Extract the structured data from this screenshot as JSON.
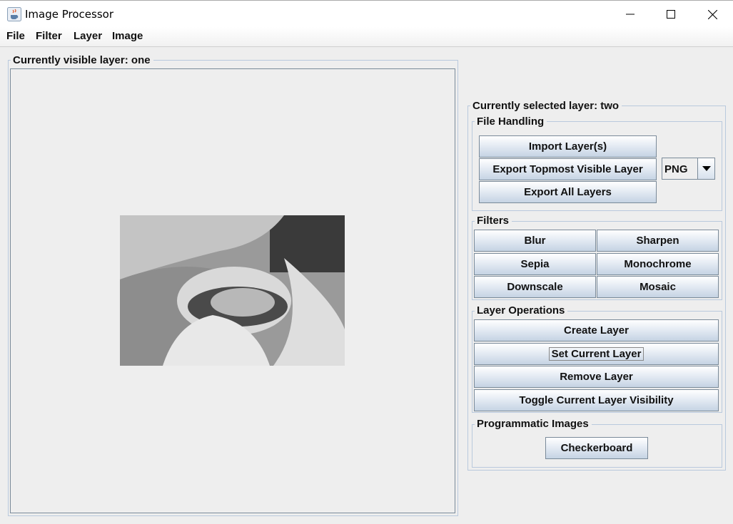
{
  "window": {
    "title": "Image Processor",
    "icon": "java-cup-icon",
    "controls": [
      "minimize-icon",
      "maximize-icon",
      "close-icon"
    ]
  },
  "menu": [
    "File",
    "Filter",
    "Layer",
    "Image"
  ],
  "canvas_panel": {
    "title": "Currently visible layer: one",
    "image_description_icon": "grayscale-photo"
  },
  "control_panel": {
    "title": "Currently selected layer: two",
    "file_handling": {
      "title": "File Handling",
      "import_label": "Import Layer(s)",
      "export_top_label": "Export Topmost Visible Layer",
      "export_all_label": "Export All Layers",
      "format_selected": "PNG"
    },
    "filters": {
      "title": "Filters",
      "blur": "Blur",
      "sharpen": "Sharpen",
      "sepia": "Sepia",
      "monochrome": "Monochrome",
      "downscale": "Downscale",
      "mosaic": "Mosaic"
    },
    "layer_ops": {
      "title": "Layer Operations",
      "create": "Create Layer",
      "set_current": "Set Current Layer",
      "remove": "Remove Layer",
      "toggle": "Toggle Current Layer Visibility"
    },
    "programmatic": {
      "title": "Programmatic Images",
      "checkerboard": "Checkerboard"
    }
  },
  "colors": {
    "button_top": "#ffffff",
    "button_bottom": "#c5d3e3",
    "border": "#7a8a99",
    "fieldset_border": "#b9c9dd",
    "background": "#eeeeee"
  }
}
